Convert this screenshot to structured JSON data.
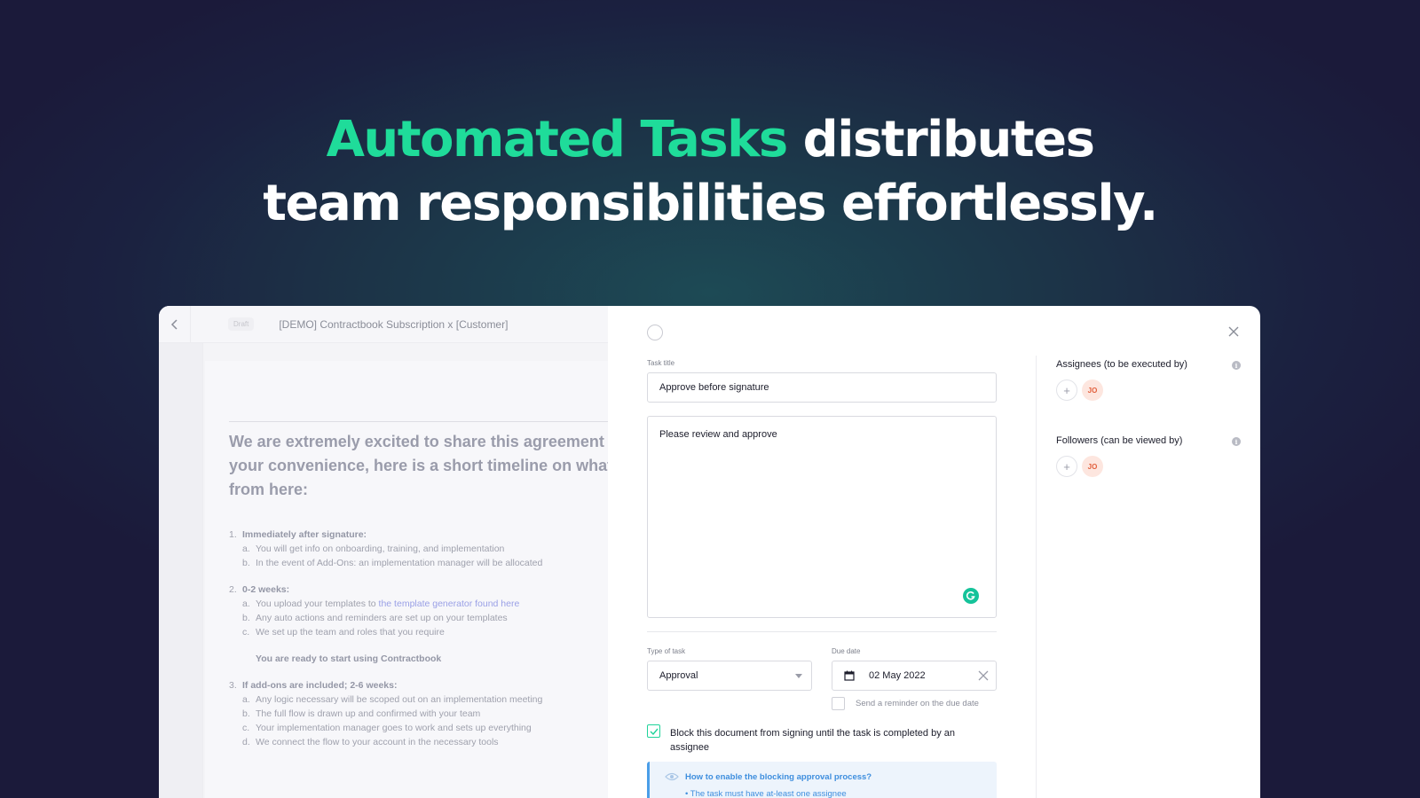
{
  "headline": {
    "accent": "Automated Tasks",
    "line1_rest": " distributes",
    "line2": "team responsibilities effortlessly."
  },
  "document": {
    "status_badge": "Draft",
    "title": "[DEMO] Contractbook Subscription x [Customer]",
    "lead": "We are extremely excited to share this agreement w\nyour convenience, here is a short timeline on what\nfrom here:",
    "sections": [
      {
        "num": "1.",
        "heading": "Immediately after signature:",
        "items": [
          {
            "letter": "a.",
            "text": "You will get info on onboarding, training, and implementation"
          },
          {
            "letter": "b.",
            "text": "In the event of Add-Ons: an implementation manager will be allocated"
          }
        ]
      },
      {
        "num": "2.",
        "heading": "0-2 weeks:",
        "items": [
          {
            "letter": "a.",
            "text": "You upload your templates to ",
            "link": "the template generator found here"
          },
          {
            "letter": "b.",
            "text": "Any auto actions and reminders are set up on your templates"
          },
          {
            "letter": "c.",
            "text": "We set up the team and roles that you require"
          }
        ],
        "note": "You are ready to start using Contractbook"
      },
      {
        "num": "3.",
        "heading": "If add-ons are included; 2-6 weeks:",
        "items": [
          {
            "letter": "a.",
            "text": "Any logic necessary will be scoped out on an implementation meeting"
          },
          {
            "letter": "b.",
            "text": "The full flow is drawn up and confirmed with your team"
          },
          {
            "letter": "c.",
            "text": "Your implementation manager goes to work and sets up everything"
          },
          {
            "letter": "d.",
            "text": "We connect the flow to your account in the necessary tools"
          }
        ]
      }
    ]
  },
  "task": {
    "title_label": "Task title",
    "title_value": "Approve before signature",
    "description_value": "Please review and approve",
    "type_label": "Type of task",
    "type_value": "Approval",
    "due_label": "Due date",
    "due_value": "02 May 2022",
    "reminder_label": "Send a reminder on the due date",
    "reminder_checked": false,
    "block_label": "Block this document from signing until the task is completed by an assignee",
    "block_checked": true,
    "info_title": "How to enable the blocking approval process?",
    "info_bullet": "The task must have at-least one assignee"
  },
  "sidebar": {
    "assignees_label": "Assignees (to be executed by)",
    "followers_label": "Followers (can be viewed by)",
    "add_symbol": "+",
    "avatar_initials": "JO",
    "info_symbol": "i"
  },
  "colors": {
    "accent": "#1fdc9a",
    "background": "#1b2140",
    "checkbox": "#1fd39a",
    "info_blue": "#3e8ede",
    "avatar_bg": "#fde6df",
    "avatar_text": "#e2603d"
  }
}
